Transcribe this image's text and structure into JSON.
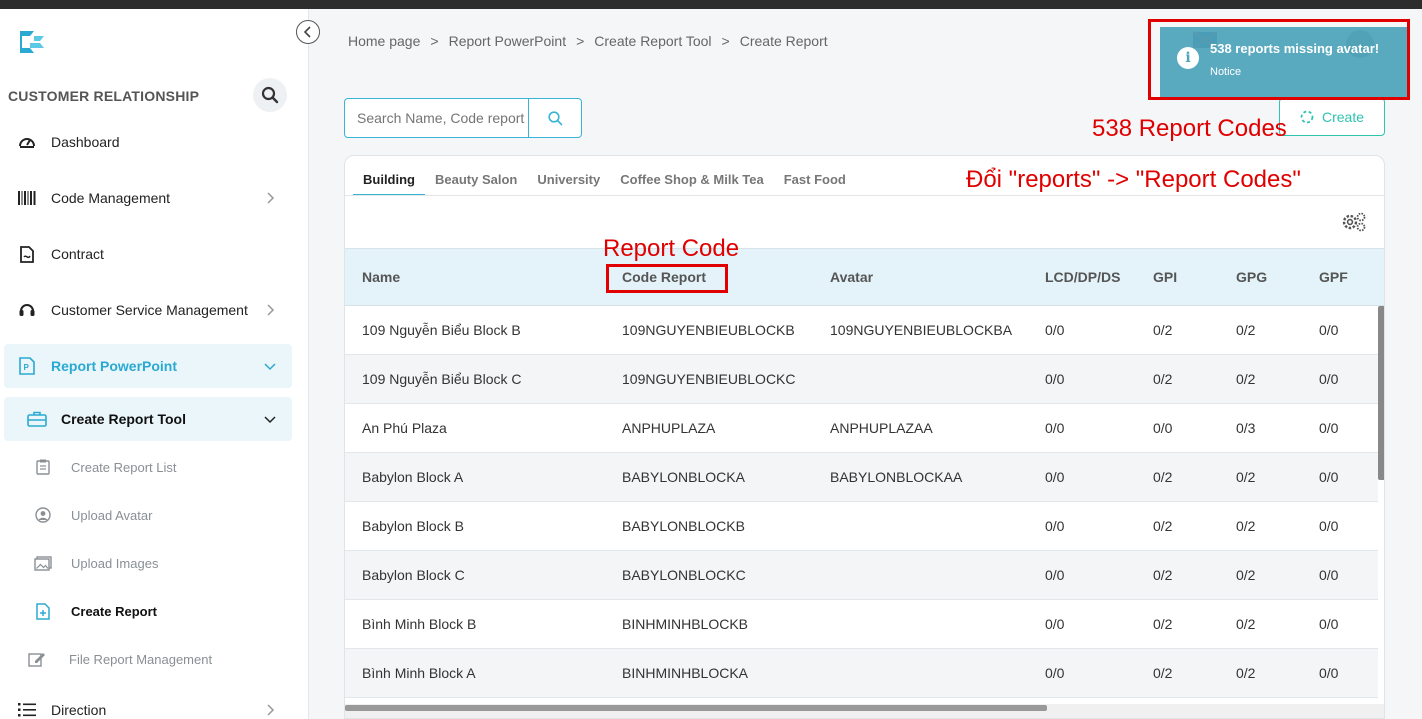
{
  "sidebar": {
    "section_title": "CUSTOMER RELATIONSHIP",
    "items": [
      {
        "label": "Dashboard",
        "icon": "speedometer-icon"
      },
      {
        "label": "Code Management",
        "icon": "barcode-icon"
      },
      {
        "label": "Contract",
        "icon": "document-icon"
      },
      {
        "label": "Customer Service Management",
        "icon": "headset-icon"
      },
      {
        "label": "Report PowerPoint",
        "icon": "powerpoint-icon"
      },
      {
        "label": "Create Report Tool",
        "icon": "toolbox-icon"
      },
      {
        "label": "Direction",
        "icon": "list-icon"
      }
    ],
    "subitems": [
      {
        "label": "Create Report List",
        "icon": "clipboard-icon"
      },
      {
        "label": "Upload Avatar",
        "icon": "user-circle-icon"
      },
      {
        "label": "Upload Images",
        "icon": "images-icon"
      },
      {
        "label": "Create Report",
        "icon": "file-plus-icon"
      },
      {
        "label": "File Report Management",
        "icon": "edit-icon"
      }
    ]
  },
  "breadcrumb": [
    "Home page",
    "Report PowerPoint",
    "Create Report Tool",
    "Create Report"
  ],
  "search": {
    "placeholder": "Search Name, Code report"
  },
  "create_button": "Create",
  "tabs": [
    "Building",
    "Beauty Salon",
    "University",
    "Coffee Shop & Milk Tea",
    "Fast Food"
  ],
  "table": {
    "headers": [
      "Name",
      "Code Report",
      "Avatar",
      "LCD/DP/DS",
      "GPI",
      "GPG",
      "GPF"
    ],
    "rows": [
      [
        "109 Nguyễn Biểu Block B",
        "109NGUYENBIEUBLOCKB",
        "109NGUYENBIEUBLOCKBA",
        "0/0",
        "0/2",
        "0/2",
        "0/0"
      ],
      [
        "109 Nguyễn Biểu Block C",
        "109NGUYENBIEUBLOCKC",
        "",
        "0/0",
        "0/2",
        "0/2",
        "0/0"
      ],
      [
        "An Phú Plaza",
        "ANPHUPLAZA",
        "ANPHUPLAZAA",
        "0/0",
        "0/0",
        "0/3",
        "0/0"
      ],
      [
        "Babylon Block A",
        "BABYLONBLOCKA",
        "BABYLONBLOCKAA",
        "0/0",
        "0/2",
        "0/2",
        "0/0"
      ],
      [
        "Babylon Block B",
        "BABYLONBLOCKB",
        "",
        "0/0",
        "0/2",
        "0/2",
        "0/0"
      ],
      [
        "Babylon Block C",
        "BABYLONBLOCKC",
        "",
        "0/0",
        "0/2",
        "0/2",
        "0/0"
      ],
      [
        "Bình Minh Block B",
        "BINHMINHBLOCKB",
        "",
        "0/0",
        "0/2",
        "0/2",
        "0/0"
      ],
      [
        "Bình Minh Block A",
        "BINHMINHBLOCKA",
        "",
        "0/0",
        "0/2",
        "0/2",
        "0/0"
      ]
    ]
  },
  "notification": {
    "message": "538 reports missing avatar!",
    "title": "Notice"
  },
  "annotations": {
    "report_codes_count": "538 Report Codes",
    "rename_note": "Đổi \"reports\" -> \"Report Codes\"",
    "column_note": "Report Code"
  },
  "colors": {
    "accent": "#37b4d8",
    "create": "#2ec4b0",
    "notice": "#4ea4ba",
    "annotation": "#e00000"
  }
}
